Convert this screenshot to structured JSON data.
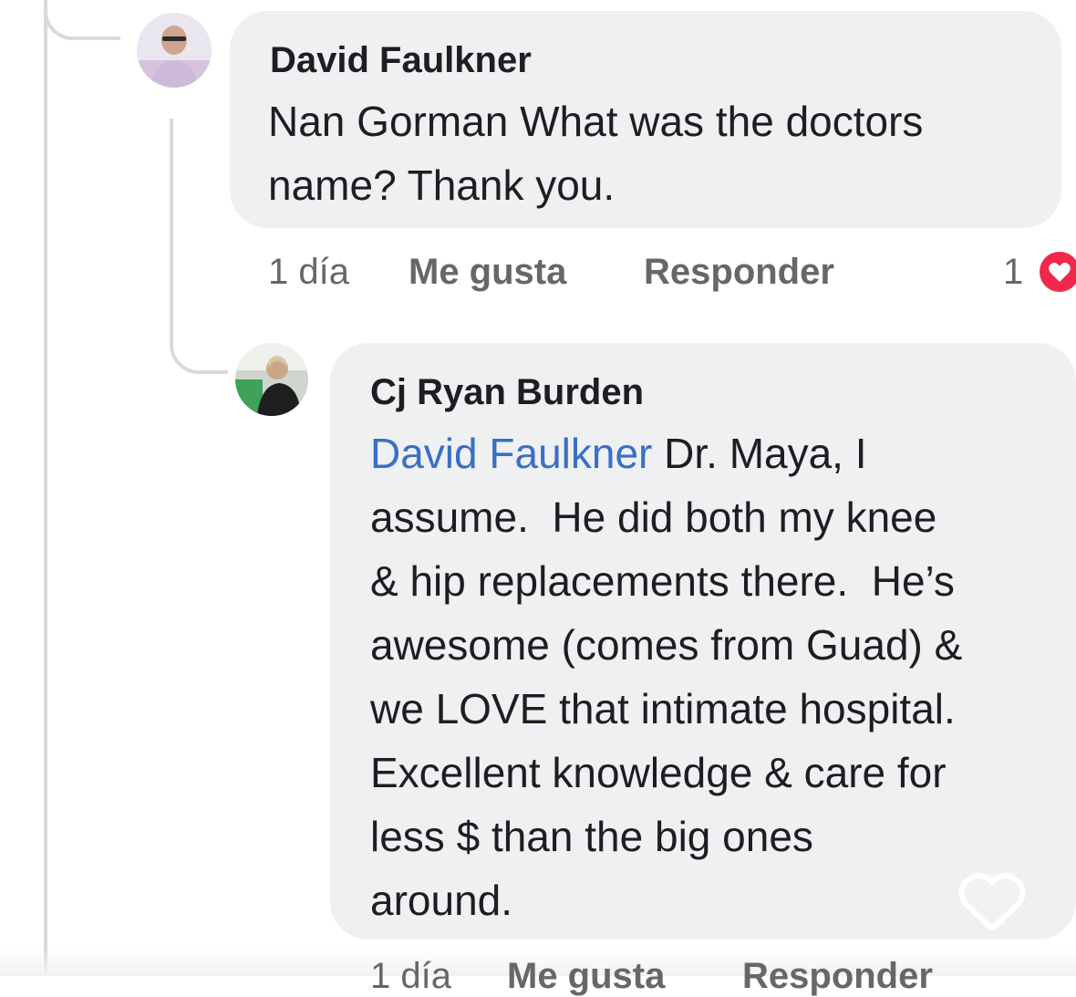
{
  "comments": [
    {
      "author": "David Faulkner",
      "text": "Nan Gorman What was the doctors name? Thank you.",
      "text_lines": [
        "Nan Gorman What was the doctors",
        "name? Thank you."
      ],
      "time": "1 día",
      "like_label": "Me gusta",
      "reply_label": "Responder",
      "reaction_count": "1",
      "reaction_icon": "heart-icon",
      "avatar_icon": "profile-photo"
    },
    {
      "author": "Cj Ryan Burden",
      "mention": "David Faulkner",
      "text_first_line_rest": " Dr. Maya, I",
      "text_lines": [
        "assume.  He did both my knee",
        "& hip replacements there.  He’s",
        "awesome (comes from Guad) &",
        "we LOVE that intimate hospital.",
        "Excellent knowledge & care for",
        "less $ than the big ones",
        "around."
      ],
      "time": "1 día",
      "like_label": "Me gusta",
      "reply_label": "Responder",
      "avatar_icon": "profile-photo"
    }
  ],
  "overlay": {
    "icon": "heart-outline-icon"
  },
  "colors": {
    "bubble": "#eff0f2",
    "mention": "#3a6fc4",
    "secondary_text": "#65676b",
    "reaction": "#f0284a"
  }
}
